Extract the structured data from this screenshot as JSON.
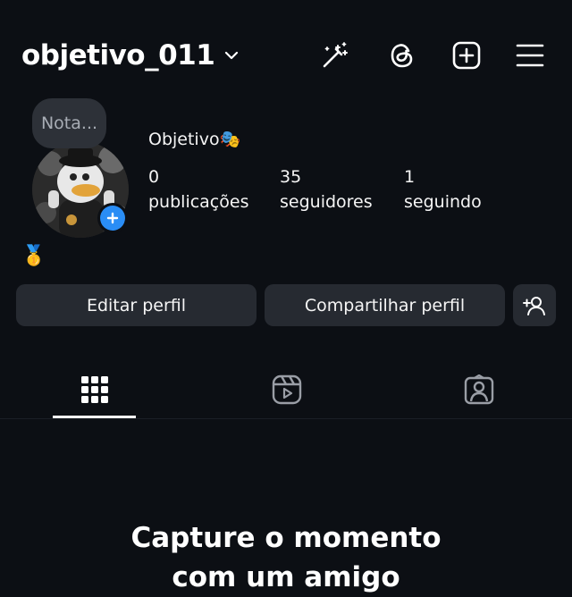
{
  "header": {
    "username": "objetivo_011",
    "icons": [
      "magic-wand-icon",
      "threads-icon",
      "create-post-icon",
      "menu-icon"
    ]
  },
  "profile": {
    "note_placeholder": "Nota...",
    "display_name": "Objetivo🎭",
    "bio_emoji": "🥇",
    "stats": [
      {
        "value": "0",
        "label": "publicações"
      },
      {
        "value": "35",
        "label": "seguidores"
      },
      {
        "value": "1",
        "label": "seguindo"
      }
    ]
  },
  "actions": {
    "edit": "Editar perfil",
    "share": "Compartilhar perfil"
  },
  "tabs": [
    "posts-grid-tab",
    "reels-tab",
    "tagged-tab"
  ],
  "empty_state": {
    "title_line1": "Capture o momento",
    "title_line2": "com um amigo"
  },
  "colors": {
    "background": "#0c0f14",
    "button": "#262a31",
    "accent_blue": "#2a8df5"
  }
}
